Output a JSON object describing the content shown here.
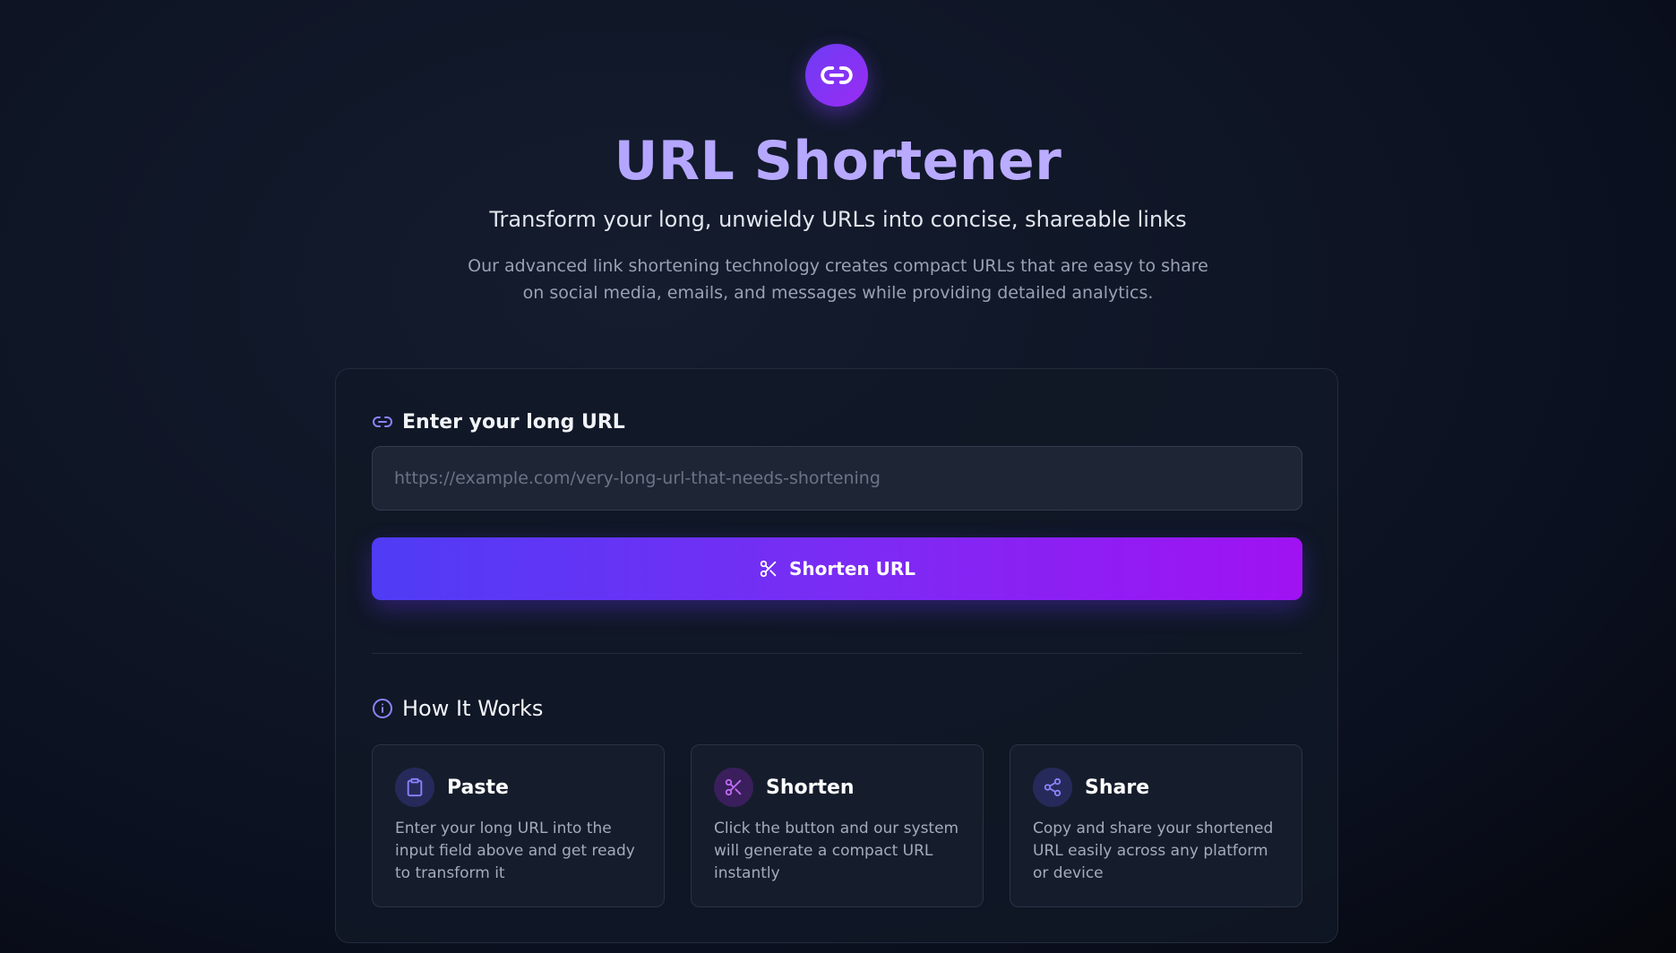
{
  "header": {
    "logo_icon": "link-icon",
    "title": "URL Shortener",
    "subtitle": "Transform your long, unwieldy URLs into concise, shareable links",
    "description": "Our advanced link shortening technology creates compact URLs that are easy to share on social media, emails, and messages while providing detailed analytics."
  },
  "form": {
    "label_icon": "link-icon",
    "label": "Enter your long URL",
    "input_value": "",
    "input_placeholder": "https://example.com/very-long-url-that-needs-shortening",
    "button_icon": "scissors-icon",
    "button_label": "Shorten URL"
  },
  "how_it_works": {
    "icon": "info-icon",
    "heading": "How It Works",
    "steps": [
      {
        "icon": "clipboard-icon",
        "title": "Paste",
        "text": "Enter your long URL into the input field above and get ready to transform it"
      },
      {
        "icon": "scissors-icon",
        "title": "Shorten",
        "text": "Click the button and our system will generate a compact URL instantly"
      },
      {
        "icon": "share-icon",
        "title": "Share",
        "text": "Copy and share your shortened URL easily across any platform or device"
      }
    ]
  },
  "colors": {
    "accent_start": "#4f3cf5",
    "accent_end": "#a012f2",
    "title": "#b4a8ff",
    "background": "#0f1626"
  }
}
